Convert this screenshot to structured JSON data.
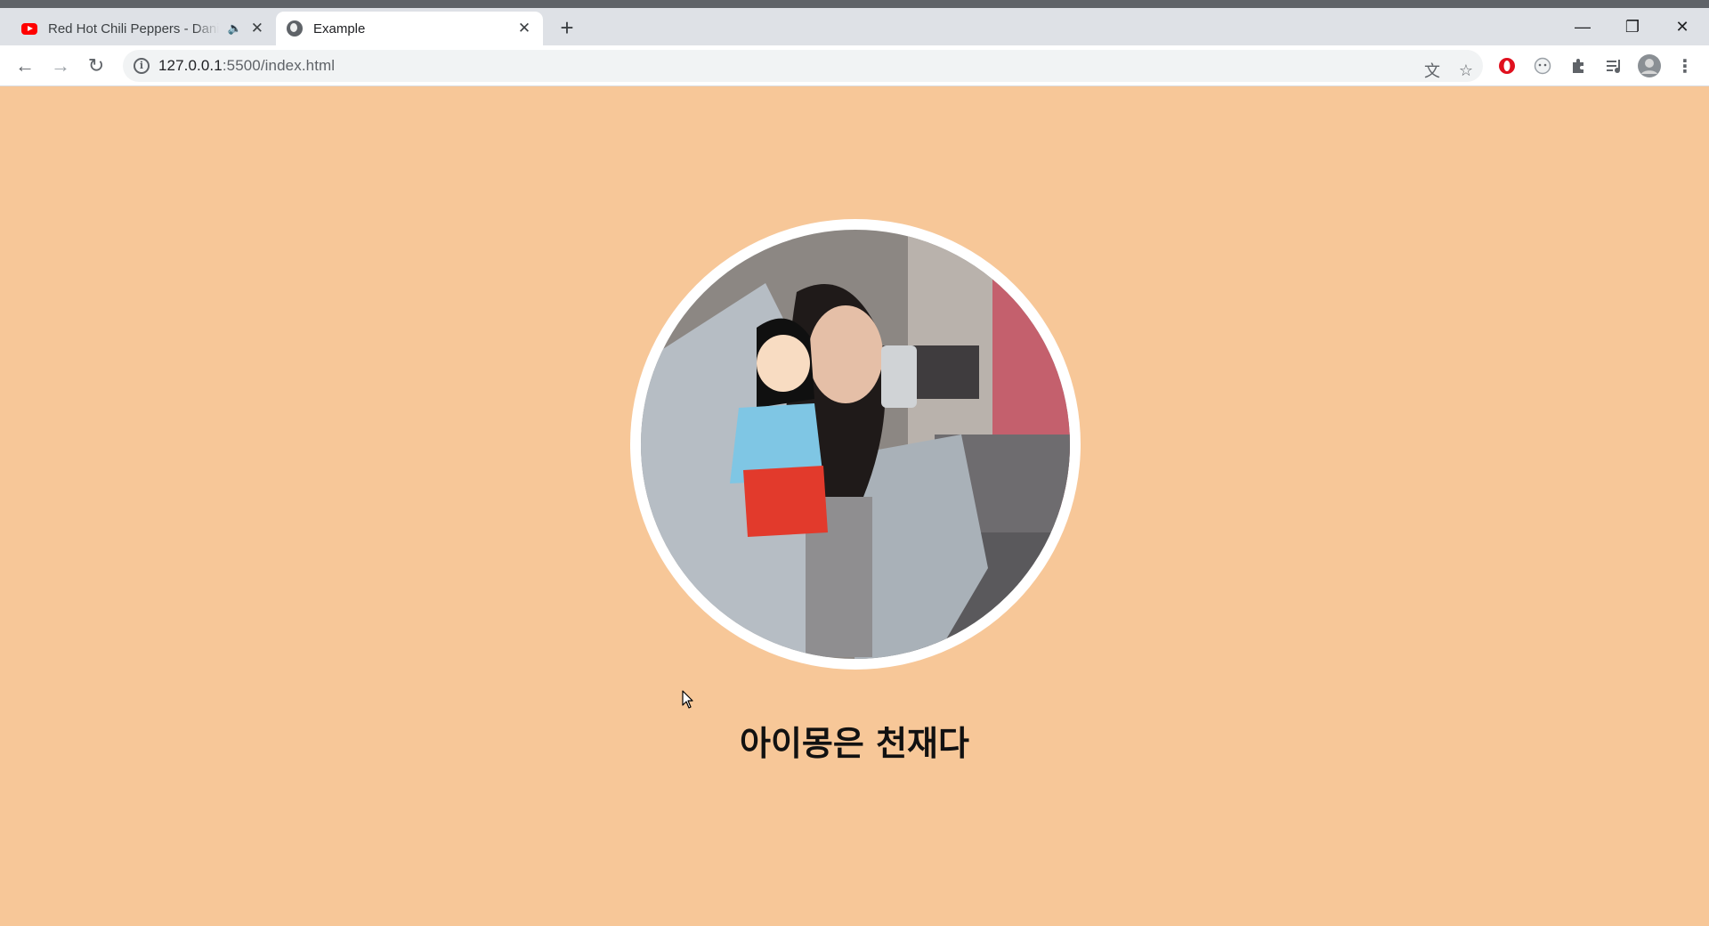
{
  "browser": {
    "tabs": [
      {
        "title": "Red Hot Chili Peppers - Dani California",
        "icon": "youtube-icon",
        "audio_icon": "speaker-icon",
        "active": false
      },
      {
        "title": "Example",
        "icon": "globe-icon",
        "active": true
      }
    ],
    "new_tab_icon": "plus-icon",
    "window_controls": [
      "minimize-icon",
      "restore-icon",
      "close-icon"
    ],
    "address": {
      "host": "127.0.0.1",
      "port_path": ":5500/index.html"
    },
    "toolbar_icons": [
      "translate-icon",
      "star-icon",
      "opera-icon",
      "extension-icon",
      "puzzle-icon",
      "media-icon",
      "profile-avatar",
      "menu-icon"
    ]
  },
  "page": {
    "background": "#f7c798",
    "profile_photo_alt": "profile photo",
    "caption": "아이몽은 천재다"
  },
  "colors": {
    "page_bg": "#f7c798",
    "ring": "#ffffff",
    "chrome_tabbar": "#dee1e6",
    "caption": "#111111"
  }
}
